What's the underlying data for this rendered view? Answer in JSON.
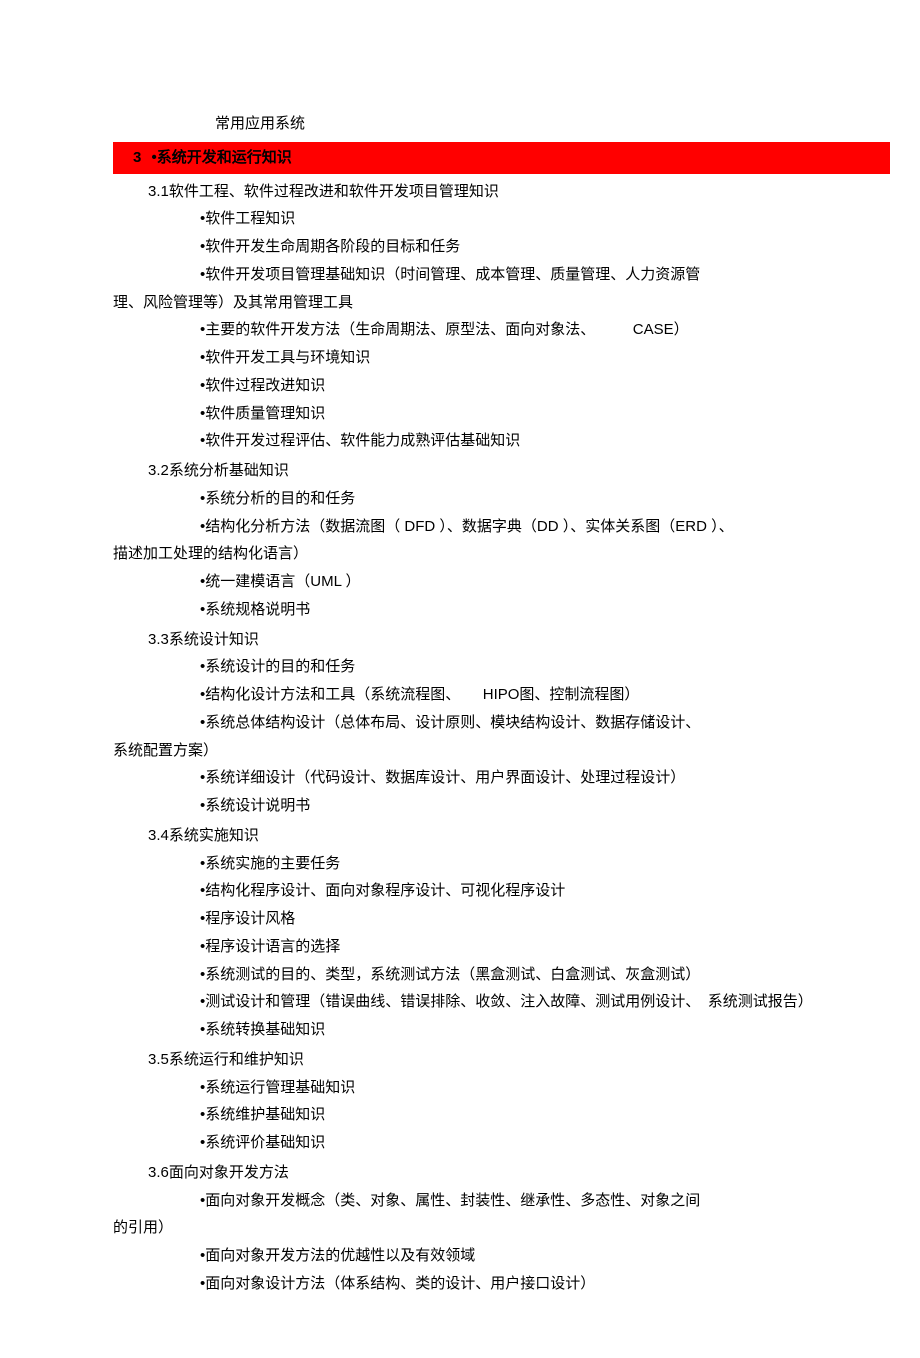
{
  "intro": "常用应用系统",
  "section3": {
    "number": "3",
    "title": "•系统开发和运行知识"
  },
  "s31": {
    "heading": "3.1软件工程、软件过程改进和软件开发项目管理知识",
    "b1": "•软件工程知识",
    "b2": "•软件开发生命周期各阶段的目标和任务",
    "b3a": "•软件开发项目管理基础知识（时间管理、成本管理、质量管理、人力资源管",
    "b3b": "理、风险管理等）及其常用管理工具",
    "b4": "•主要的软件开发方法（生命周期法、原型法、面向对象法、　　　CASE）",
    "b5": "•软件开发工具与环境知识",
    "b6": "•软件过程改进知识",
    "b7": "•软件质量管理知识",
    "b8": "•软件开发过程评估、软件能力成熟评估基础知识"
  },
  "s32": {
    "heading": "3.2系统分析基础知识",
    "b1": "•系统分析的目的和任务",
    "b2a": "•结构化分析方法（数据流图（ DFD ）、数据字典（DD ）、实体关系图（ERD ）、",
    "b2b": "描述加工处理的结构化语言）",
    "b3": "•统一建模语言（UML ）",
    "b4": "•系统规格说明书"
  },
  "s33": {
    "heading": "3.3系统设计知识",
    "b1": "•系统设计的目的和任务",
    "b2": "•结构化设计方法和工具（系统流程图、　　HIPO图、控制流程图）",
    "b3a": "•系统总体结构设计（总体布局、设计原则、模块结构设计、数据存储设计、",
    "b3b": "系统配置方案）",
    "b4": "•系统详细设计（代码设计、数据库设计、用户界面设计、处理过程设计）",
    "b5": "•系统设计说明书"
  },
  "s34": {
    "heading": "3.4系统实施知识",
    "b1": "•系统实施的主要任务",
    "b2": "•结构化程序设计、面向对象程序设计、可视化程序设计",
    "b3": "•程序设计风格",
    "b4": "•程序设计语言的选择",
    "b5": "•系统测试的目的、类型，系统测试方法（黑盒测试、白盒测试、灰盒测试）",
    "b6": "•测试设计和管理（错误曲线、错误排除、收敛、注入故障、测试用例设计、　系统测试报告）",
    "b7": "•系统转换基础知识"
  },
  "s35": {
    "heading": "3.5系统运行和维护知识",
    "b1": "•系统运行管理基础知识",
    "b2": "•系统维护基础知识",
    "b3": "•系统评价基础知识"
  },
  "s36": {
    "heading": "3.6面向对象开发方法",
    "b1a": "•面向对象开发概念（类、对象、属性、封装性、继承性、多态性、对象之间",
    "b1b": "的引用）",
    "b2": "•面向对象开发方法的优越性以及有效领域",
    "b3": "•面向对象设计方法（体系结构、类的设计、用户接口设计）"
  }
}
